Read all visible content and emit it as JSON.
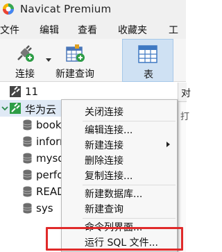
{
  "window": {
    "title": "Navicat Premium"
  },
  "menubar": {
    "items": [
      "文件",
      "编辑",
      "查看",
      "收藏夹",
      "工具"
    ]
  },
  "toolbar": {
    "connect_label": "连接",
    "new_query_label": "新建查询",
    "table_label": "表"
  },
  "tree": {
    "connections": [
      {
        "label": "11"
      },
      {
        "label": "华为云"
      }
    ],
    "databases": [
      "book",
      "inforr",
      "mysq",
      "perfo",
      "READ",
      "sys"
    ]
  },
  "right_panel": {
    "frag1": "对",
    "frag2": "打"
  },
  "context_menu": {
    "items": [
      {
        "label": "关闭连接"
      },
      {
        "label": "编辑连接..."
      },
      {
        "label": "新建连接"
      },
      {
        "label": "删除连接"
      },
      {
        "label": "复制连接..."
      },
      {
        "label": "新建数据库..."
      },
      {
        "label": "新建查询"
      },
      {
        "label": "命令列界面..."
      },
      {
        "label": "运行 SQL 文件..."
      }
    ],
    "highlighted_item": "运行 SQL 文件..."
  },
  "colors": {
    "highlight_border": "#e02a2a",
    "selection_bg": "#dfe9f5",
    "active_tool_bg": "#cfe1f3"
  }
}
